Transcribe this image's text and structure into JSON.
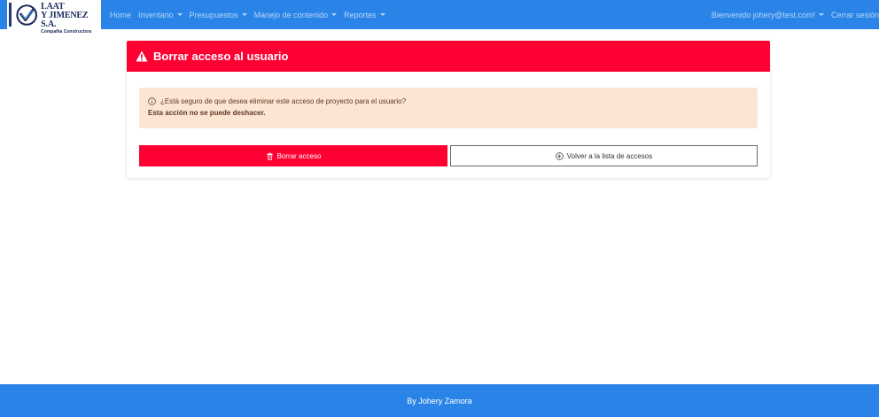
{
  "brand": {
    "line1": "VAN DER LAAT",
    "line2": "Y JIMENEZ S.A.",
    "line3": "Compañía Constructora"
  },
  "nav": {
    "home": "Home",
    "inventario": "Inventario",
    "presupuestos": "Presupuestos",
    "manejo": "Manejo de contenido",
    "reportes": "Reportes",
    "user_menu": "Bienvenido johery@test.com!",
    "logout": "Cerrar sesión"
  },
  "card": {
    "title": "Borrar acceso al usuario",
    "question": "¿Está seguro de que desea eliminar este acceso de proyecto para el usuario?",
    "warning": "Esta acción no se puede deshacer.",
    "delete_label": "Borrar acceso",
    "back_label": "Volver a la lista de accesos"
  },
  "footer": {
    "text": "By Johery Zamora"
  },
  "icons": {
    "warning": "warning-triangle-icon",
    "info": "info-circle-icon",
    "trash": "trash-icon",
    "back": "arrow-left-circle-icon"
  },
  "colors": {
    "primary": "#2a84e8",
    "danger": "#ff0033",
    "alert_bg": "#fde5d4"
  }
}
